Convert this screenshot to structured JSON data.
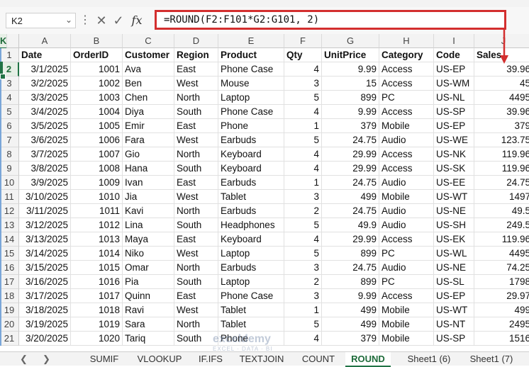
{
  "formula_bar": {
    "cell_ref": "K2",
    "formula": "=ROUND(F2:F101*G2:G101, 2)",
    "fx_label": "fx"
  },
  "columns": [
    "A",
    "B",
    "C",
    "D",
    "E",
    "F",
    "G",
    "H",
    "I",
    "J",
    "K"
  ],
  "selected_column": "K",
  "selected_row": "2",
  "rows": [
    {
      "n": "1",
      "c": [
        "Date",
        "OrderID",
        "Customer",
        "Region",
        "Product",
        "Qty",
        "UnitPrice",
        "Category",
        "Code",
        "Sales"
      ]
    },
    {
      "n": "2",
      "c": [
        "3/1/2025",
        "1001",
        "Ava",
        "East",
        "Phone Case",
        "4",
        "9.99",
        "Access",
        "US-EP",
        "39.96"
      ]
    },
    {
      "n": "3",
      "c": [
        "3/2/2025",
        "1002",
        "Ben",
        "West",
        "Mouse",
        "3",
        "15",
        "Access",
        "US-WM",
        "45"
      ]
    },
    {
      "n": "4",
      "c": [
        "3/3/2025",
        "1003",
        "Chen",
        "North",
        "Laptop",
        "5",
        "899",
        "PC",
        "US-NL",
        "4495"
      ]
    },
    {
      "n": "5",
      "c": [
        "3/4/2025",
        "1004",
        "Diya",
        "South",
        "Phone Case",
        "4",
        "9.99",
        "Access",
        "US-SP",
        "39.96"
      ]
    },
    {
      "n": "6",
      "c": [
        "3/5/2025",
        "1005",
        "Emir",
        "East",
        "Phone",
        "1",
        "379",
        "Mobile",
        "US-EP",
        "379"
      ]
    },
    {
      "n": "7",
      "c": [
        "3/6/2025",
        "1006",
        "Fara",
        "West",
        "Earbuds",
        "5",
        "24.75",
        "Audio",
        "US-WE",
        "123.75"
      ]
    },
    {
      "n": "8",
      "c": [
        "3/7/2025",
        "1007",
        "Gio",
        "North",
        "Keyboard",
        "4",
        "29.99",
        "Access",
        "US-NK",
        "119.96"
      ]
    },
    {
      "n": "9",
      "c": [
        "3/8/2025",
        "1008",
        "Hana",
        "South",
        "Keyboard",
        "4",
        "29.99",
        "Access",
        "US-SK",
        "119.96"
      ]
    },
    {
      "n": "10",
      "c": [
        "3/9/2025",
        "1009",
        "Ivan",
        "East",
        "Earbuds",
        "1",
        "24.75",
        "Audio",
        "US-EE",
        "24.75"
      ]
    },
    {
      "n": "11",
      "c": [
        "3/10/2025",
        "1010",
        "Jia",
        "West",
        "Tablet",
        "3",
        "499",
        "Mobile",
        "US-WT",
        "1497"
      ]
    },
    {
      "n": "12",
      "c": [
        "3/11/2025",
        "1011",
        "Kavi",
        "North",
        "Earbuds",
        "2",
        "24.75",
        "Audio",
        "US-NE",
        "49.5"
      ]
    },
    {
      "n": "13",
      "c": [
        "3/12/2025",
        "1012",
        "Lina",
        "South",
        "Headphones",
        "5",
        "49.9",
        "Audio",
        "US-SH",
        "249.5"
      ]
    },
    {
      "n": "14",
      "c": [
        "3/13/2025",
        "1013",
        "Maya",
        "East",
        "Keyboard",
        "4",
        "29.99",
        "Access",
        "US-EK",
        "119.96"
      ]
    },
    {
      "n": "15",
      "c": [
        "3/14/2025",
        "1014",
        "Niko",
        "West",
        "Laptop",
        "5",
        "899",
        "PC",
        "US-WL",
        "4495"
      ]
    },
    {
      "n": "16",
      "c": [
        "3/15/2025",
        "1015",
        "Omar",
        "North",
        "Earbuds",
        "3",
        "24.75",
        "Audio",
        "US-NE",
        "74.25"
      ]
    },
    {
      "n": "17",
      "c": [
        "3/16/2025",
        "1016",
        "Pia",
        "South",
        "Laptop",
        "2",
        "899",
        "PC",
        "US-SL",
        "1798"
      ]
    },
    {
      "n": "18",
      "c": [
        "3/17/2025",
        "1017",
        "Quinn",
        "East",
        "Phone Case",
        "3",
        "9.99",
        "Access",
        "US-EP",
        "29.97"
      ]
    },
    {
      "n": "19",
      "c": [
        "3/18/2025",
        "1018",
        "Ravi",
        "West",
        "Tablet",
        "1",
        "499",
        "Mobile",
        "US-WT",
        "499"
      ]
    },
    {
      "n": "20",
      "c": [
        "3/19/2025",
        "1019",
        "Sara",
        "North",
        "Tablet",
        "5",
        "499",
        "Mobile",
        "US-NT",
        "2495"
      ]
    },
    {
      "n": "21",
      "c": [
        "3/20/2025",
        "1020",
        "Tariq",
        "South",
        "Phone",
        "4",
        "379",
        "Mobile",
        "US-SP",
        "1516"
      ]
    }
  ],
  "sheet_tabs": [
    "SUMIF",
    "VLOOKUP",
    "IF.IFS",
    "TEXTJOIN",
    "COUNT",
    "ROUND",
    "Sheet1 (6)",
    "Sheet1 (7)"
  ],
  "active_tab": "ROUND",
  "watermark": {
    "name": "exceldemy",
    "tagline": "EXCEL · DATA · BI"
  },
  "colors": {
    "accent": "#217346",
    "highlight": "#d32f2f"
  }
}
